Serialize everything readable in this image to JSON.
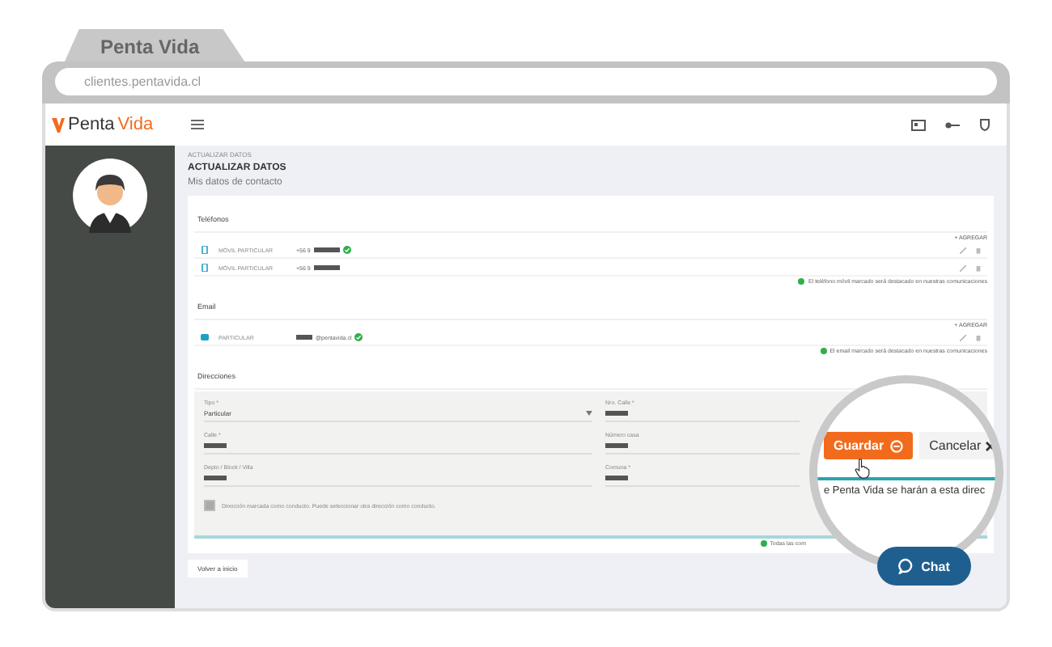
{
  "browser": {
    "tab_title": "Penta Vida",
    "url": "clientes.pentavida.cl"
  },
  "header": {
    "logo_left": "Penta",
    "logo_right": "Vida"
  },
  "breadcrumb": "ACTUALIZAR DATOS",
  "page_title": "ACTUALIZAR DATOS",
  "page_subtitle": "Mis datos de contacto",
  "phones": {
    "title": "Teléfonos",
    "add_label": "+ AGREGAR",
    "items": [
      {
        "label": "MÓVIL PARTICULAR",
        "prefix": "+56 9",
        "verified": true
      },
      {
        "label": "MÓVIL PARTICULAR",
        "prefix": "+56 9",
        "verified": false
      }
    ],
    "note": "El teléfono móvil marcado será destacado en nuestras comunicaciones"
  },
  "emails": {
    "title": "Email",
    "add_label": "+ AGREGAR",
    "items": [
      {
        "label": "PARTICULAR",
        "suffix": "@pentavida.cl",
        "verified": true
      }
    ],
    "note": "El email marcado será destacado en nuestras comunicaciones"
  },
  "addresses": {
    "title": "Direcciones",
    "fields": [
      {
        "label": "Tipo *",
        "value": "Particular",
        "kind": "select"
      },
      {
        "label": "Nro. Calle *",
        "kind": "masked"
      },
      {
        "label": "Calle *",
        "kind": "masked"
      },
      {
        "label": "Número casa",
        "kind": "masked"
      },
      {
        "label": "Depto / Block / Villa",
        "kind": "masked"
      },
      {
        "label": "Comuna *",
        "kind": "masked"
      }
    ],
    "checkbox": {
      "label": "Dirección marcada como conducto. Puede seleccionar otra dirección como conducto.",
      "checked": true
    },
    "note": "Todas las com"
  },
  "back_button": "Volver a inicio",
  "magnifier": {
    "save": "Guardar",
    "cancel": "Cancelar",
    "text": "e Penta Vida se harán a esta direc"
  },
  "chat": "Chat"
}
